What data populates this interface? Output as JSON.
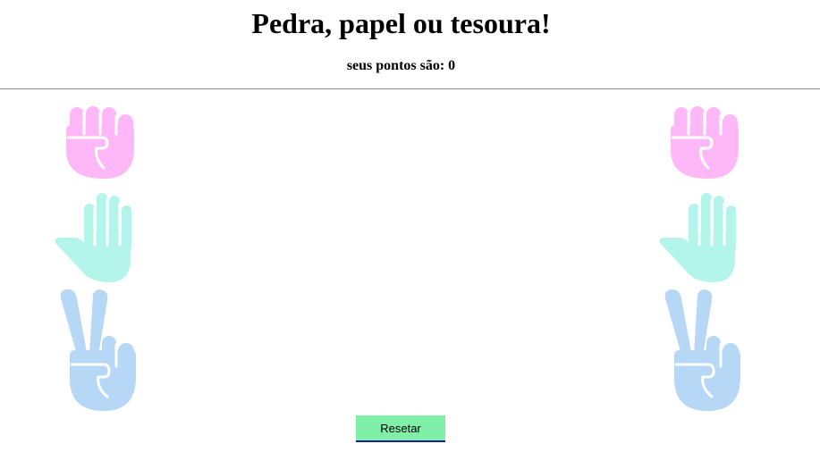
{
  "header": {
    "title": "Pedra, papel ou tesoura!",
    "score_text": "seus pontos são: 0"
  },
  "choices": [
    {
      "id": "pedra",
      "icon": "rock-fist-icon",
      "color": "#ffb8f7"
    },
    {
      "id": "papel",
      "icon": "paper-hand-icon",
      "color": "#b3f5ea"
    },
    {
      "id": "tesoura",
      "icon": "scissors-victory-icon",
      "color": "#b6d7f5"
    }
  ],
  "controls": {
    "reset_label": "Resetar",
    "reset_color": "#80f0a8"
  },
  "colors": {
    "divider": "#8c8c8c",
    "text": "#000000"
  }
}
